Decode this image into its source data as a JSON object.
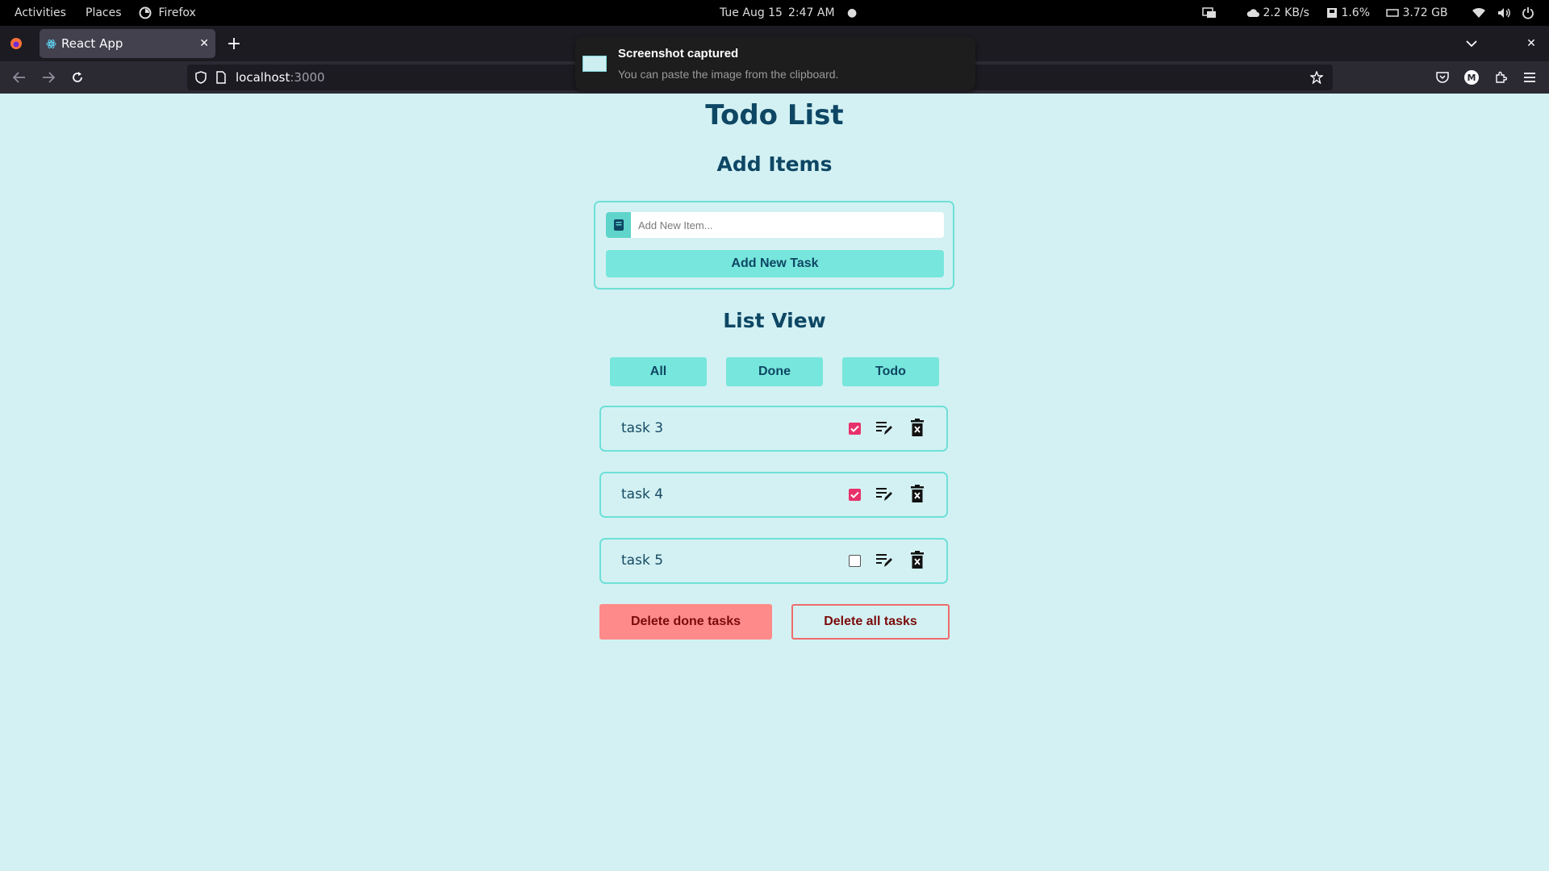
{
  "system_bar": {
    "activities": "Activities",
    "places": "Places",
    "app": "Firefox",
    "datetime": "Tue Aug 15",
    "time": "2:47 AM",
    "net_speed": "2.2 KB/s",
    "cpu": "1.6%",
    "memory": "3.72 GB"
  },
  "browser": {
    "tab_title": "React App",
    "url_host": "localhost",
    "url_port": ":3000"
  },
  "notification": {
    "title": "Screenshot captured",
    "body": "You can paste the image from the clipboard."
  },
  "app": {
    "title": "Todo List",
    "add_heading": "Add Items",
    "input_placeholder": "Add New Item...",
    "add_button": "Add New Task",
    "list_heading": "List View",
    "filters": [
      "All",
      "Done",
      "Todo"
    ],
    "tasks": [
      {
        "name": "task 3",
        "done": true
      },
      {
        "name": "task 4",
        "done": true
      },
      {
        "name": "task 5",
        "done": false
      }
    ],
    "delete_done": "Delete done tasks",
    "delete_all": "Delete all tasks"
  },
  "colors": {
    "background": "#d3f1f3",
    "accent": "#77e6dc",
    "heading": "#0e4764",
    "checkbox_checked": "#e8316a",
    "danger_fill": "#ff8a8a"
  }
}
